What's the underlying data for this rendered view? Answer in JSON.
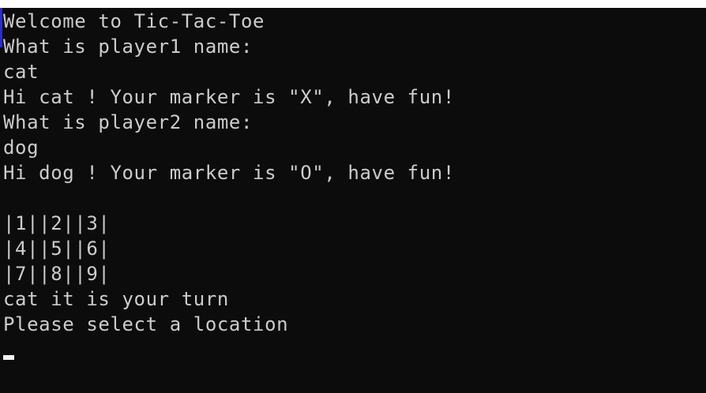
{
  "console": {
    "lines": [
      "Welcome to Tic-Tac-Toe",
      "What is player1 name:",
      "cat",
      "Hi cat ! Your marker is \"X\", have fun!",
      "What is player2 name:",
      "dog",
      "Hi dog ! Your marker is \"O\", have fun!",
      "",
      "|1||2||3|",
      "|4||5||6|",
      "|7||8||9|",
      "cat it is your turn",
      "Please select a location"
    ]
  },
  "colors": {
    "background": "#0c0c0c",
    "text": "#cccccc",
    "cursor": "#f2f2f2",
    "edge_accent": "#2b2bd6"
  }
}
